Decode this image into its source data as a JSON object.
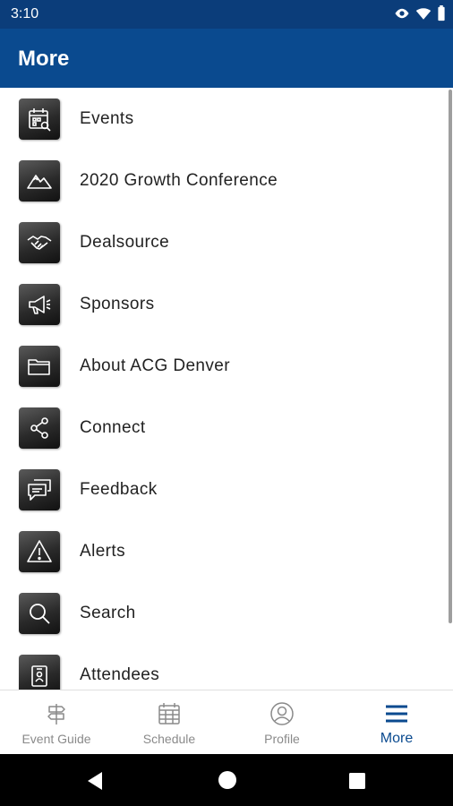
{
  "status_bar": {
    "time": "3:10"
  },
  "app_bar": {
    "title": "More"
  },
  "menu": {
    "items": [
      {
        "label": "Events",
        "icon": "calendar-search-icon"
      },
      {
        "label": "2020 Growth Conference",
        "icon": "mountains-icon"
      },
      {
        "label": "Dealsource",
        "icon": "handshake-icon"
      },
      {
        "label": "Sponsors",
        "icon": "megaphone-icon"
      },
      {
        "label": "About ACG Denver",
        "icon": "folder-icon"
      },
      {
        "label": "Connect",
        "icon": "share-icon"
      },
      {
        "label": "Feedback",
        "icon": "chat-bubbles-icon"
      },
      {
        "label": "Alerts",
        "icon": "warning-icon"
      },
      {
        "label": "Search",
        "icon": "search-icon"
      },
      {
        "label": "Attendees",
        "icon": "badge-icon"
      }
    ]
  },
  "bottom_nav": {
    "tabs": [
      {
        "label": "Event Guide",
        "icon": "signpost-icon",
        "active": false
      },
      {
        "label": "Schedule",
        "icon": "calendar-icon",
        "active": false
      },
      {
        "label": "Profile",
        "icon": "person-icon",
        "active": false
      },
      {
        "label": "More",
        "icon": "menu-icon",
        "active": true
      }
    ]
  },
  "colors": {
    "status_bar": "#0b3d7a",
    "app_bar": "#0a4a8f",
    "active_tab": "#0a4a8f",
    "inactive_tab": "#8a8a8a",
    "system_nav": "#000000"
  }
}
